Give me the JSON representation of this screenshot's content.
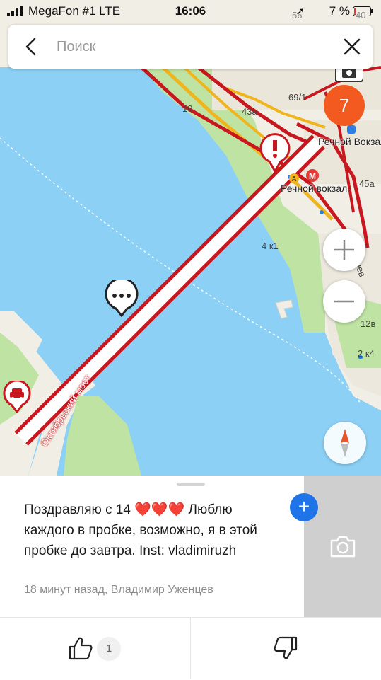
{
  "status_bar": {
    "carrier": "MegaFon #1  LTE",
    "time": "16:06",
    "battery": "7 %"
  },
  "search": {
    "placeholder": "Поиск"
  },
  "map": {
    "labels": {
      "bridge": "Октябрьский мост",
      "station": "Речной вокзал",
      "station2": "Речной Вокзал",
      "house_10": "10",
      "house_43a": "43а",
      "house_69_1": "69/1",
      "house_45a": "45а",
      "house_4k1": "4 к1",
      "house_12v": "12в",
      "house_2k4": "2 к4",
      "house_56": "56",
      "house_40": "40",
      "street_shev": "шев"
    },
    "cluster_count": "7",
    "colors": {
      "water": "#8dd0f5",
      "park": "#bfe3a3",
      "traffic_jam": "#c8171f",
      "traffic_slow": "#f0b51c",
      "accent": "#f35a1f"
    }
  },
  "comment": {
    "text": "Поздравляю с 14 ❤️❤️❤️ Люблю каждого в пробке, возможно, я в этой пробке до завтра. Inst: vladimiruzh",
    "meta": "18 минут назад, Владимир Уженцев"
  },
  "actions": {
    "like_count": "1"
  }
}
